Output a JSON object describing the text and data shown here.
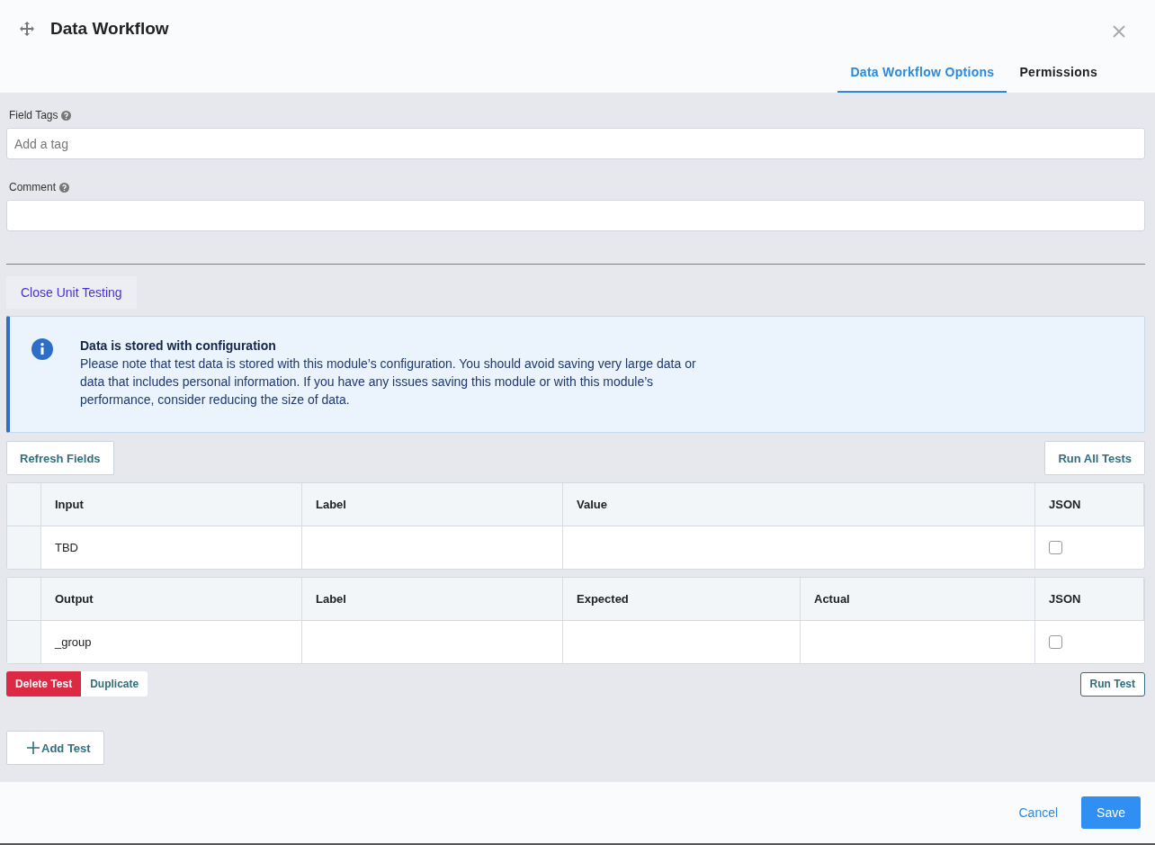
{
  "window": {
    "title": "Data Workflow"
  },
  "tabs": [
    {
      "label": "Data Workflow Options",
      "selected": true
    },
    {
      "label": "Permissions",
      "selected": false
    }
  ],
  "fields": [
    {
      "label": "Field Tags",
      "placeholder": "Add a tag"
    },
    {
      "label": "Comment"
    }
  ],
  "unit_testing": {
    "toggle_button": "Close Unit Testing",
    "notice": {
      "title": "Data is stored with configuration",
      "body": "Please note that test data is stored with this module’s configuration. You should avoid saving very large data or data that includes personal information. If you have any issues saving this module or with this module’s performance, consider reducing the size of data."
    },
    "refresh_button": "Refresh Fields",
    "run_all_button": "Run All Tests",
    "input_table": {
      "columns": [
        "Input",
        "Label",
        "Value",
        "JSON"
      ],
      "rows": [
        {
          "name": "TBD",
          "json_checked": false
        }
      ]
    },
    "output_table": {
      "columns": [
        "Output",
        "Label",
        "Expected",
        "Actual",
        "JSON"
      ],
      "rows": [
        {
          "name": "_group",
          "json_checked": false
        }
      ]
    },
    "delete_button": "Delete Test",
    "duplicate_button": "Duplicate",
    "run_button": "Run Test",
    "add_button": "Add Test"
  },
  "footer": {
    "cancel": "Cancel",
    "save": "Save"
  }
}
